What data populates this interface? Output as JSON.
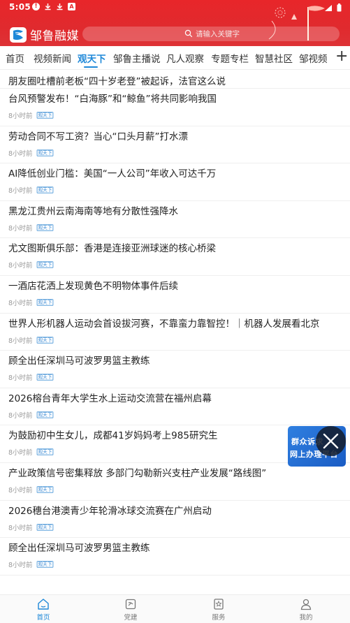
{
  "status_bar": {
    "time": "5:05",
    "icons": [
      "alert-icon",
      "download-icon",
      "download-icon",
      "app-icon"
    ]
  },
  "brand": {
    "name": "邹鲁融媒"
  },
  "search": {
    "placeholder": "请输入关键字"
  },
  "tabs": [
    {
      "label": "首页",
      "active": false
    },
    {
      "label": "视频新闻",
      "active": false
    },
    {
      "label": "观天下",
      "active": true
    },
    {
      "label": "邹鲁主播说",
      "active": false
    },
    {
      "label": "凡人观察",
      "active": false
    },
    {
      "label": "专题专栏",
      "active": false
    },
    {
      "label": "智慧社区",
      "active": false
    },
    {
      "label": "邹视频",
      "active": false
    }
  ],
  "news": [
    {
      "title": "朋友圈吐槽前老板“四十岁老登”被起诉，法官这么说",
      "time": "",
      "tag": ""
    },
    {
      "title": "台风预警发布！“白海豚”和“鲸鱼”将共同影响我国",
      "time": "8小时前",
      "tag": "观天下"
    },
    {
      "title": "劳动合同不写工资？当心“口头月薪”打水漂",
      "time": "8小时前",
      "tag": "观天下"
    },
    {
      "title": "AI降低创业门槛：美国“一人公司”年收入可达千万",
      "time": "8小时前",
      "tag": "观天下"
    },
    {
      "title": "黑龙江贵州云南海南等地有分散性强降水",
      "time": "8小时前",
      "tag": "观天下"
    },
    {
      "title": "尤文图斯俱乐部：香港是连接亚洲球迷的核心桥梁",
      "time": "8小时前",
      "tag": "观天下"
    },
    {
      "title": "一酒店花洒上发现黄色不明物体事件后续",
      "time": "8小时前",
      "tag": "观天下"
    },
    {
      "title": "世界人形机器人运动会首设拔河赛，不靠蛮力靠智控！｜机器人发展看北京",
      "time": "8小时前",
      "tag": "观天下"
    },
    {
      "title": "顾全出任深圳马可波罗男篮主教练",
      "time": "8小时前",
      "tag": "观天下"
    },
    {
      "title": "2026榕台青年大学生水上运动交流营在福州启幕",
      "time": "8小时前",
      "tag": "观天下"
    },
    {
      "title": "为鼓励初中生女儿，成都41岁妈妈考上985研究生",
      "time": "8小时前",
      "tag": "观天下"
    },
    {
      "title": "产业政策信号密集释放  多部门勾勒新兴支柱产业发展“路线图”",
      "time": "8小时前",
      "tag": "观天下"
    },
    {
      "title": "2026穗台港澳青少年轮滑冰球交流赛在广州启动",
      "time": "8小时前",
      "tag": "观天下"
    },
    {
      "title": "顾全出任深圳马可波罗男篮主教练",
      "time": "8小时前",
      "tag": "观天下"
    }
  ],
  "float_ad": {
    "line1": "群众诉求",
    "line2": "网上办理平台"
  },
  "bottom_nav": [
    {
      "label": "首页",
      "icon": "home-icon",
      "active": true
    },
    {
      "label": "党建",
      "icon": "party-building-icon",
      "active": false
    },
    {
      "label": "服务",
      "icon": "service-icon",
      "active": false
    },
    {
      "label": "我的",
      "icon": "profile-icon",
      "active": false
    }
  ],
  "colors": {
    "header_red": "#e8262a",
    "accent_blue": "#1e88d8",
    "tag_blue": "#3d8bd4"
  }
}
